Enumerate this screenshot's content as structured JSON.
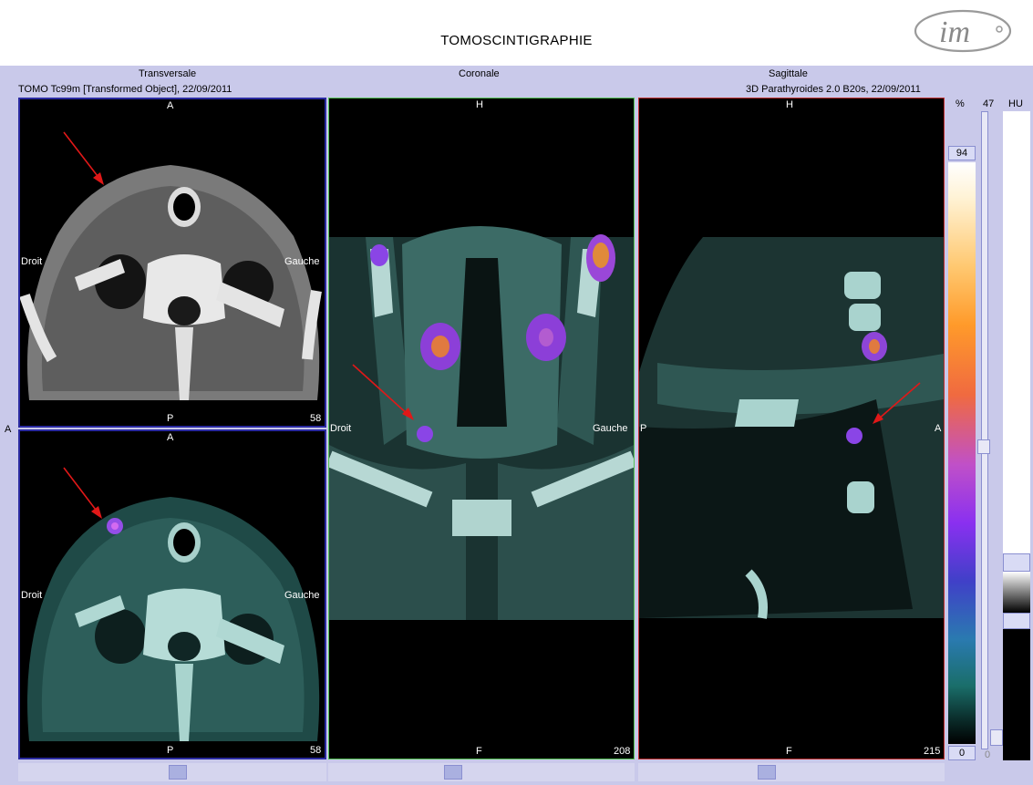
{
  "header": {
    "title": "TOMOSCINTIGRAPHIE",
    "logo_text": "im"
  },
  "views": {
    "transverse": {
      "label": "Transversale",
      "info": "TOMO Tc99m [Transformed Object], 22/09/2011"
    },
    "coronal": {
      "label": "Coronale"
    },
    "sagittal": {
      "label": "Sagittale",
      "info": "3D Parathyroides  2.0  B20s, 22/09/2011"
    }
  },
  "panels": {
    "trans_ct": {
      "top": "A",
      "bottom": "P",
      "left": "Droit",
      "right": "Gauche",
      "slice": "58"
    },
    "trans_fused": {
      "top": "A",
      "bottom": "P",
      "left": "Droit",
      "right": "Gauche",
      "slice": "58"
    },
    "coronal": {
      "top": "H",
      "bottom": "F",
      "left": "Droit",
      "right": "Gauche",
      "slice": "208"
    },
    "sagittal": {
      "top": "H",
      "bottom": "F",
      "left": "P",
      "right": "A",
      "slice": "215"
    }
  },
  "side_marker": "A",
  "colorbar": {
    "unit": "%",
    "max": "94",
    "min": "0"
  },
  "ct_window": {
    "unit": "HU",
    "level": "47",
    "min": "0"
  },
  "colors": {
    "trans_frame": "#2a2aa0",
    "coronal_frame": "#55c255",
    "sagittal_frame": "#c23030",
    "arrow": "#e01818"
  }
}
